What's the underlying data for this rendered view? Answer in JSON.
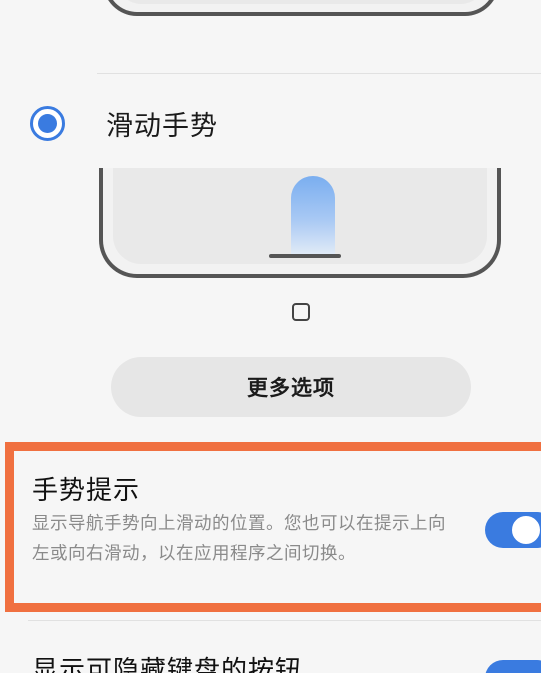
{
  "navigation_options": {
    "swipe_gestures_label": "滑动手势",
    "swipe_gestures_selected": true
  },
  "more_options_label": "更多选项",
  "settings": [
    {
      "title": "手势提示",
      "description": "显示导航手势向上滑动的位置。您也可以在提示上向左或向右滑动，以在应用程序之间切换。",
      "enabled": true
    },
    {
      "title": "显示可隐藏键盘的按钮",
      "enabled": true
    }
  ],
  "colors": {
    "accent": "#3a7be0",
    "highlight_border": "#f07040"
  }
}
